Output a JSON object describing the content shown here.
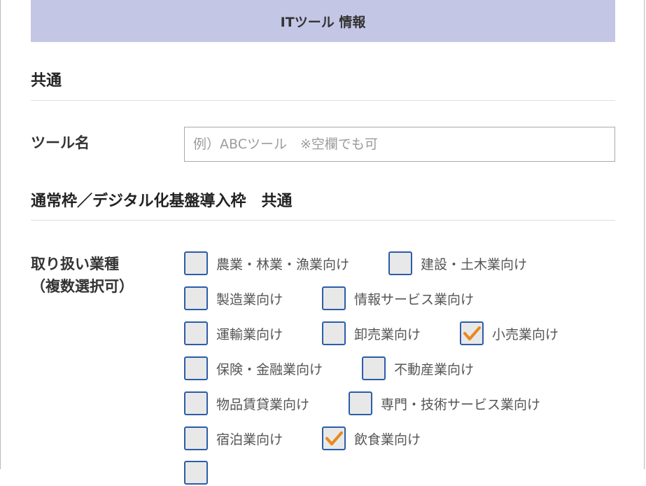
{
  "header": {
    "title": "ITツール 情報"
  },
  "common": {
    "heading": "共通"
  },
  "tool_name": {
    "label": "ツール名",
    "placeholder": "例）ABCツール　※空欄でも可",
    "value": ""
  },
  "normal_frame": {
    "heading": "通常枠／デジタル化基盤導入枠　共通"
  },
  "industry": {
    "label_line1": "取り扱い業種",
    "label_line2": "（複数選択可）",
    "rows": [
      [
        {
          "label": "農業・林業・漁業向け",
          "checked": false
        },
        {
          "label": "建設・土木業向け",
          "checked": false
        }
      ],
      [
        {
          "label": "製造業向け",
          "checked": false
        },
        {
          "label": "情報サービス業向け",
          "checked": false
        }
      ],
      [
        {
          "label": "運輸業向け",
          "checked": false
        },
        {
          "label": "卸売業向け",
          "checked": false
        },
        {
          "label": "小売業向け",
          "checked": true
        }
      ],
      [
        {
          "label": "保険・金融業向け",
          "checked": false
        },
        {
          "label": "不動産業向け",
          "checked": false
        }
      ],
      [
        {
          "label": "物品賃貸業向け",
          "checked": false
        },
        {
          "label": "専門・技術サービス業向け",
          "checked": false
        }
      ],
      [
        {
          "label": "宿泊業向け",
          "checked": false
        },
        {
          "label": "飲食業向け",
          "checked": true
        }
      ]
    ]
  },
  "colors": {
    "header_bg": "#c4c6e6",
    "checkbox_border": "#2c5da8",
    "checkmark": "#e8891e"
  }
}
